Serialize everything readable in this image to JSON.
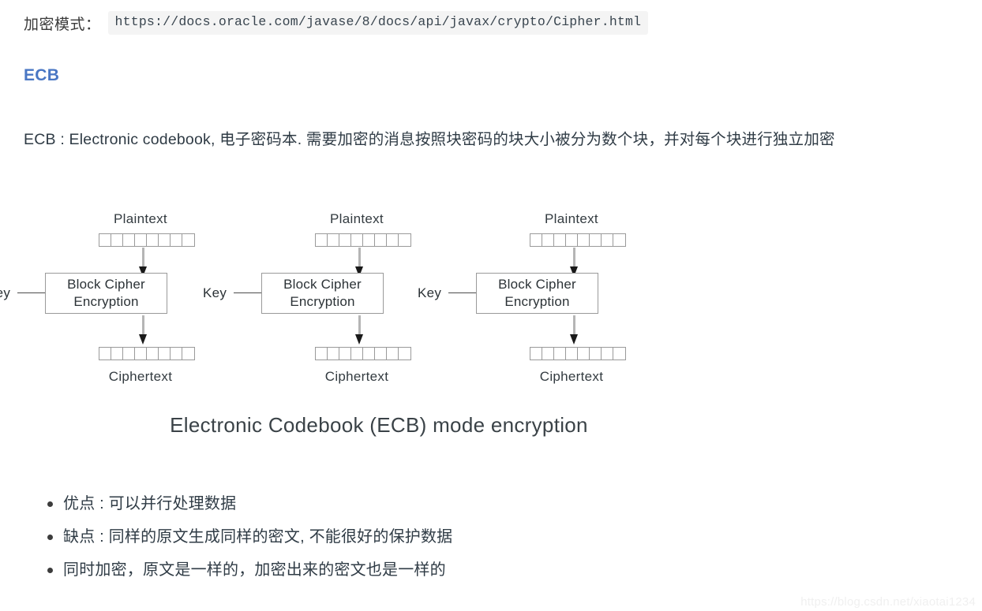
{
  "top_line": {
    "label": "加密模式：",
    "code_url": "https://docs.oracle.com/javase/8/docs/api/javax/crypto/Cipher.html"
  },
  "heading": {
    "text": "ECB",
    "color": "#4a77c4"
  },
  "intro_paragraph": "ECB : Electronic codebook, 电子密码本. 需要加密的消息按照块密码的块大小被分为数个块，并对每个块进行独立加密",
  "diagram": {
    "caption": "Electronic Codebook (ECB) mode encryption",
    "columns": [
      {
        "plaintext_label": "Plaintext",
        "key_label": "Key",
        "box_line1": "Block Cipher",
        "box_line2": "Encryption",
        "ciphertext_label": "Ciphertext",
        "plaintext_cells": 8,
        "ciphertext_cells": 8
      },
      {
        "plaintext_label": "Plaintext",
        "key_label": "Key",
        "box_line1": "Block Cipher",
        "box_line2": "Encryption",
        "ciphertext_label": "Ciphertext",
        "plaintext_cells": 8,
        "ciphertext_cells": 8
      },
      {
        "plaintext_label": "Plaintext",
        "key_label": "Key",
        "box_line1": "Block Cipher",
        "box_line2": "Encryption",
        "ciphertext_label": "Ciphertext",
        "plaintext_cells": 8,
        "ciphertext_cells": 8
      }
    ],
    "arrow_icon_in": "arrow-down-icon",
    "arrow_icon_out": "arrow-down-icon",
    "arrow_icon_key": "arrow-right-icon",
    "box_border_color": "#9a9a9a",
    "arrow_shaft_color": "#b5b5b5"
  },
  "bullets": [
    "优点 : 可以并行处理数据",
    "缺点 : 同样的原文生成同样的密文, 不能很好的保护数据",
    "同时加密，原文是一样的，加密出来的密文也是一样的"
  ],
  "watermark": "https://blog.csdn.net/xiaotai1234"
}
